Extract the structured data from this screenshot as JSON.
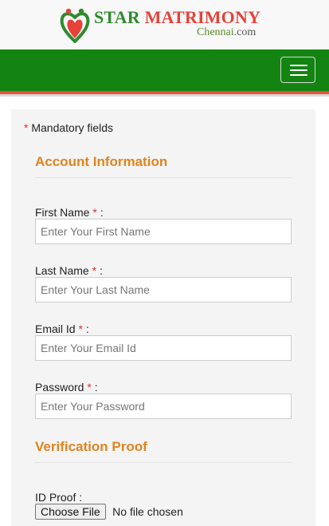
{
  "logo": {
    "word1": "STAR",
    "word2": "MATRIMONY",
    "sub_city": "Chennai",
    "sub_tld": ".com",
    "brand_green": "#2e8b2e",
    "brand_red": "#e5423a"
  },
  "nav": {
    "bg_color": "#138412",
    "stripe_color": "#e4533f",
    "menu_icon": "hamburger-icon"
  },
  "form": {
    "required_mark": "*",
    "mandatory_note": "Mandatory fields",
    "sections": {
      "account": "Account Information",
      "verification": "Verification Proof"
    },
    "fields": {
      "first_name": {
        "label": "First Name",
        "placeholder": "Enter Your First Name"
      },
      "last_name": {
        "label": "Last Name",
        "placeholder": "Enter Your Last Name"
      },
      "email": {
        "label": "Email Id",
        "placeholder": "Enter Your Email Id"
      },
      "password": {
        "label": "Password",
        "placeholder": "Enter Your Password"
      }
    },
    "label_suffix": ":",
    "id_proof": {
      "label": "ID Proof :",
      "button": "Choose File",
      "status": "No file chosen"
    },
    "accent_color": "#e0841f"
  }
}
